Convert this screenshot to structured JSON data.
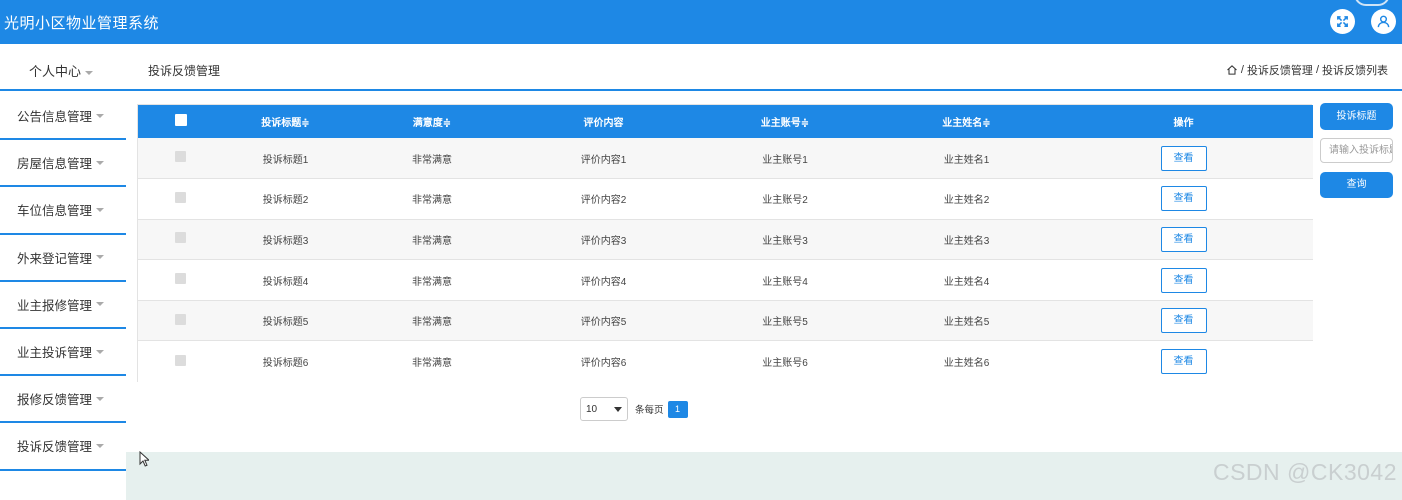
{
  "app": {
    "title": "光明小区物业管理系统"
  },
  "topbar": {
    "icons": [
      "expand-icon",
      "user-icon"
    ]
  },
  "header": {
    "personal_center": "个人中心",
    "page_heading": "投诉反馈管理",
    "breadcrumb": {
      "home_icon": "home-icon",
      "sep1": "/",
      "level1": "投诉反馈管理",
      "sep2": "/",
      "level2": "投诉反馈列表"
    }
  },
  "sidebar": {
    "items": [
      {
        "label": "公告信息管理"
      },
      {
        "label": "房屋信息管理"
      },
      {
        "label": "车位信息管理"
      },
      {
        "label": "外来登记管理"
      },
      {
        "label": "业主报修管理"
      },
      {
        "label": "业主投诉管理"
      },
      {
        "label": "报修反馈管理"
      },
      {
        "label": "投诉反馈管理"
      }
    ]
  },
  "table": {
    "columns": [
      "投诉标题≑",
      "满意度≑",
      "评价内容",
      "业主账号≑",
      "业主姓名≑",
      "操作"
    ],
    "rows": [
      {
        "title": "投诉标题1",
        "satisfaction": "非常满意",
        "content": "评价内容1",
        "account": "业主账号1",
        "name": "业主姓名1",
        "action": "查看"
      },
      {
        "title": "投诉标题2",
        "satisfaction": "非常满意",
        "content": "评价内容2",
        "account": "业主账号2",
        "name": "业主姓名2",
        "action": "查看"
      },
      {
        "title": "投诉标题3",
        "satisfaction": "非常满意",
        "content": "评价内容3",
        "account": "业主账号3",
        "name": "业主姓名3",
        "action": "查看"
      },
      {
        "title": "投诉标题4",
        "satisfaction": "非常满意",
        "content": "评价内容4",
        "account": "业主账号4",
        "name": "业主姓名4",
        "action": "查看"
      },
      {
        "title": "投诉标题5",
        "satisfaction": "非常满意",
        "content": "评价内容5",
        "account": "业主账号5",
        "name": "业主姓名5",
        "action": "查看"
      },
      {
        "title": "投诉标题6",
        "satisfaction": "非常满意",
        "content": "评价内容6",
        "account": "业主账号6",
        "name": "业主姓名6",
        "action": "查看"
      }
    ]
  },
  "search": {
    "label": "投诉标题",
    "placeholder": "请输入投诉标题",
    "query_label": "查询"
  },
  "pagination": {
    "page_size": "10",
    "per_page_label": "条每页",
    "current_page": "1"
  },
  "watermark": "CSDN @CK3042",
  "colors": {
    "primary": "#1e88e5",
    "row_alt": "#f7f7f7",
    "bottom_strip": "#e6f0ee"
  }
}
